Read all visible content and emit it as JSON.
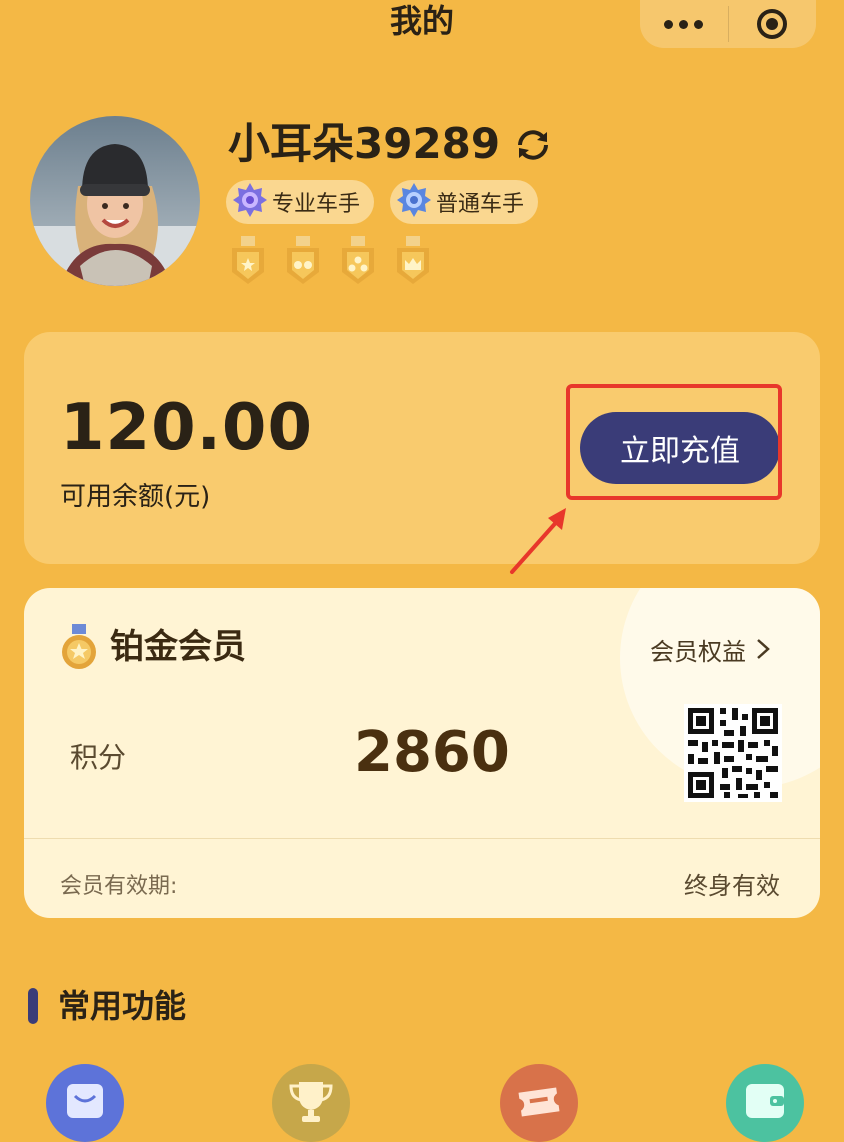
{
  "header": {
    "title": "我的"
  },
  "capsule": {
    "more_icon": "more-dots-icon",
    "close_icon": "target-icon"
  },
  "profile": {
    "username": "小耳朵39289",
    "badges": [
      {
        "label": "专业车手",
        "icon": "purple-star-badge-icon"
      },
      {
        "label": "普通车手",
        "icon": "blue-star-badge-icon"
      }
    ],
    "medals": [
      "medal-1-star-icon",
      "medal-2-star-icon",
      "medal-3-star-icon",
      "medal-crown-icon"
    ]
  },
  "balance": {
    "amount": "120.00",
    "label": "可用余额(元)",
    "recharge_label": "立即充值"
  },
  "member": {
    "title": "铂金会员",
    "benefits_label": "会员权益",
    "points_label": "积分",
    "points_value": "2860",
    "validity_label": "会员有效期:",
    "validity_value": "终身有效"
  },
  "functions": {
    "title": "常用功能",
    "icons": [
      "shopping-bag-icon",
      "trophy-icon",
      "ticket-icon",
      "wallet-icon"
    ]
  },
  "colors": {
    "background": "#F4B845",
    "accent": "#3A3C78",
    "highlight": "#E8372B",
    "member_card": "#FFF4D4"
  }
}
